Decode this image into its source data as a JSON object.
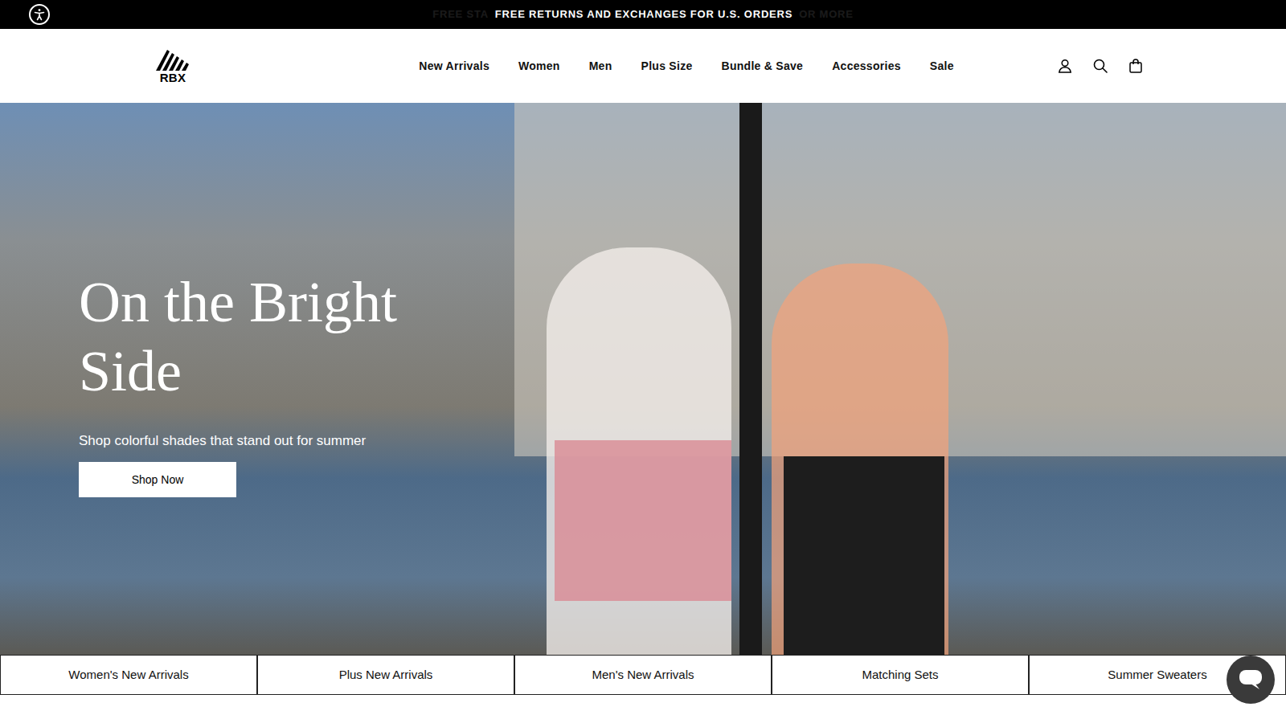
{
  "announcement": {
    "previous": "FREE STA",
    "text": "FREE RETURNS AND EXCHANGES FOR U.S. ORDERS",
    "next": "OR MORE"
  },
  "logo": {
    "text": "RBX"
  },
  "nav": [
    "New Arrivals",
    "Women",
    "Men",
    "Plus Size",
    "Bundle & Save",
    "Accessories",
    "Sale"
  ],
  "hero": {
    "title": "On the Bright Side",
    "subtitle": "Shop colorful shades that stand out for summer",
    "button": "Shop Now"
  },
  "categories": [
    "Women's New Arrivals",
    "Plus New Arrivals",
    "Men's New Arrivals",
    "Matching Sets",
    "Summer Sweaters"
  ]
}
